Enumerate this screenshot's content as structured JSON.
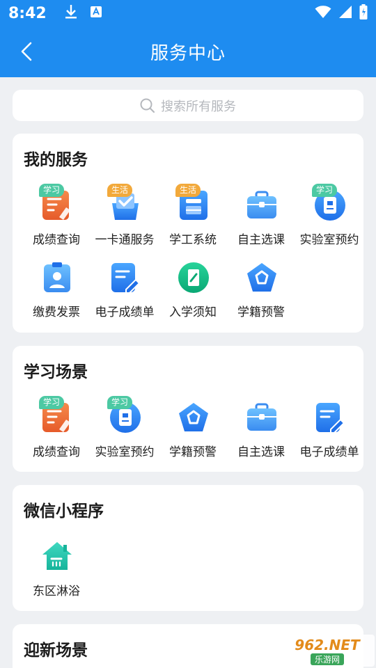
{
  "status_bar": {
    "time": "8:42",
    "icons_left": [
      "download-icon",
      "app-notification-icon"
    ],
    "icons_right": [
      "wifi-icon",
      "signal-icon",
      "battery-charging-icon"
    ]
  },
  "nav": {
    "title": "服务中心",
    "back_icon": "chevron-left-icon"
  },
  "search": {
    "placeholder": "搜索所有服务",
    "icon": "search-icon"
  },
  "sections": [
    {
      "title": "我的服务",
      "items": [
        {
          "label": "成绩查询",
          "badge": "学习",
          "icon": "grades-icon"
        },
        {
          "label": "一卡通服务",
          "badge": "生活",
          "icon": "card-service-icon"
        },
        {
          "label": "学工系统",
          "badge": "生活",
          "icon": "student-affairs-icon"
        },
        {
          "label": "自主选课",
          "badge": "",
          "icon": "briefcase-icon"
        },
        {
          "label": "实验室预约",
          "badge": "学习",
          "icon": "lab-booking-icon"
        },
        {
          "label": "缴费发票",
          "badge": "",
          "icon": "invoice-icon"
        },
        {
          "label": "电子成绩单",
          "badge": "",
          "icon": "transcript-icon"
        },
        {
          "label": "入学须知",
          "badge": "",
          "icon": "enrollment-notice-icon"
        },
        {
          "label": "学籍预警",
          "badge": "",
          "icon": "warning-pentagon-icon"
        }
      ]
    },
    {
      "title": "学习场景",
      "items": [
        {
          "label": "成绩查询",
          "badge": "学习",
          "icon": "grades-icon"
        },
        {
          "label": "实验室预约",
          "badge": "学习",
          "icon": "lab-booking-icon"
        },
        {
          "label": "学籍预警",
          "badge": "",
          "icon": "warning-pentagon-icon"
        },
        {
          "label": "自主选课",
          "badge": "",
          "icon": "briefcase-icon"
        },
        {
          "label": "电子成绩单",
          "badge": "",
          "icon": "transcript-icon"
        }
      ]
    },
    {
      "title": "微信小程序",
      "items": [
        {
          "label": "东区淋浴",
          "badge": "",
          "icon": "shower-house-icon"
        }
      ]
    },
    {
      "title": "迎新场景",
      "items": []
    }
  ],
  "watermark": {
    "top": "962.NET",
    "bottom": "乐游网"
  },
  "colors": {
    "header": "#1e8cf0",
    "badge_study": "#4cc9a3",
    "badge_life": "#f2a93b"
  }
}
